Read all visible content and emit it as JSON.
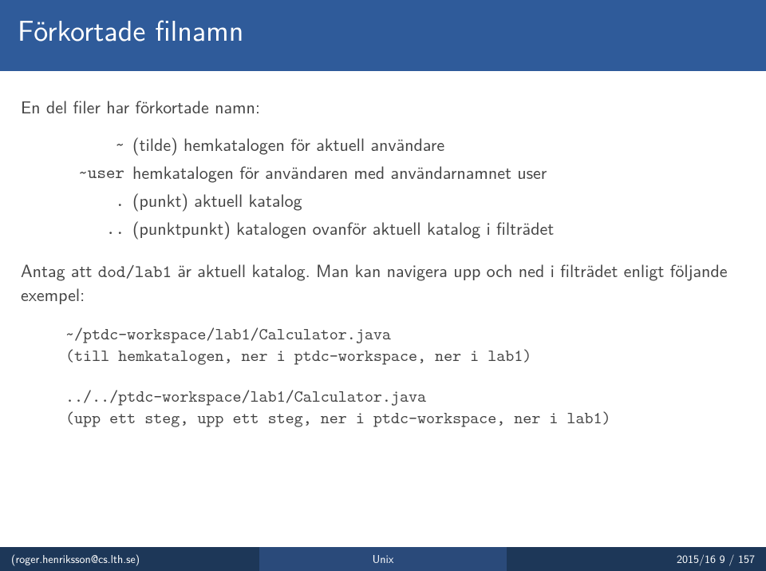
{
  "title": "Förkortade filnamn",
  "intro": "En del filer har förkortade namn:",
  "defs": [
    {
      "term": "~",
      "desc": "(tilde) hemkatalogen för aktuell användare"
    },
    {
      "term": "~user",
      "desc": "hemkatalogen för användaren med användarnamnet user"
    },
    {
      "term": ".",
      "desc": "(punkt) aktuell katalog"
    },
    {
      "term": "..",
      "desc": "(punktpunkt) katalogen ovanför aktuell katalog i filträdet"
    }
  ],
  "para2_pre": "Antag att ",
  "para2_code": "dod/lab1",
  "para2_post": " är aktuell katalog. Man kan navigera upp och ned i filträdet enligt följande exempel:",
  "code1_line1": "~/ptdc-workspace/lab1/Calculator.java",
  "code1_line2": "(till hemkatalogen, ner i ptdc-workspace, ner i lab1)",
  "code2_line1": "../../ptdc-workspace/lab1/Calculator.java",
  "code2_line2": "(upp ett steg, upp ett steg, ner i ptdc-workspace, ner i lab1)",
  "footer": {
    "left": "(roger.henriksson@cs.lth.se)",
    "center": "Unix",
    "right": "2015/16    9 / 157"
  }
}
